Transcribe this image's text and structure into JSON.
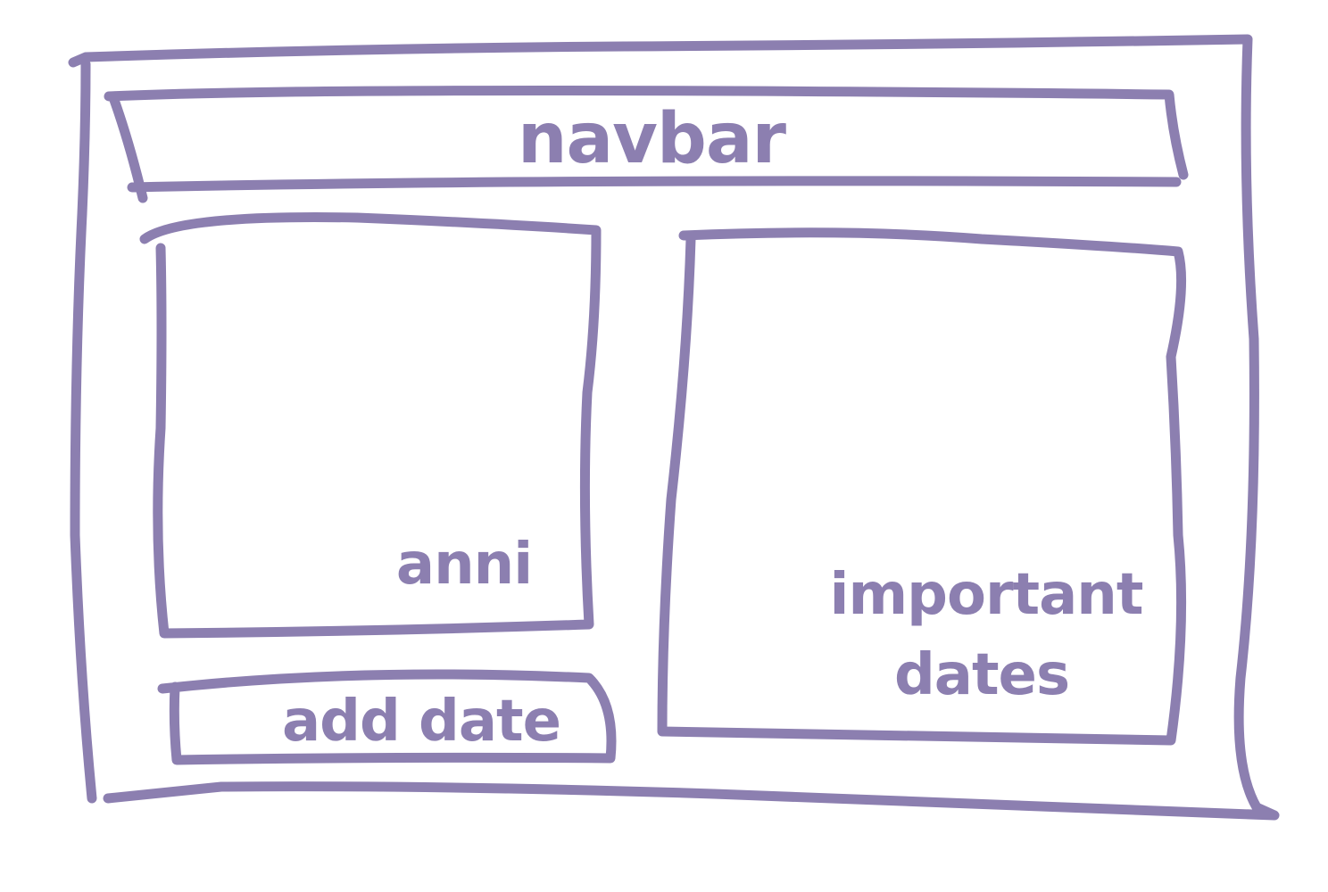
{
  "sketch": {
    "stroke_color": "#8c7fb0",
    "navbar": {
      "label": "navbar"
    },
    "left_panel": {
      "label": "anni"
    },
    "add_date": {
      "label": "add date"
    },
    "right_panel": {
      "label_line1": "important",
      "label_line2": "dates"
    }
  }
}
